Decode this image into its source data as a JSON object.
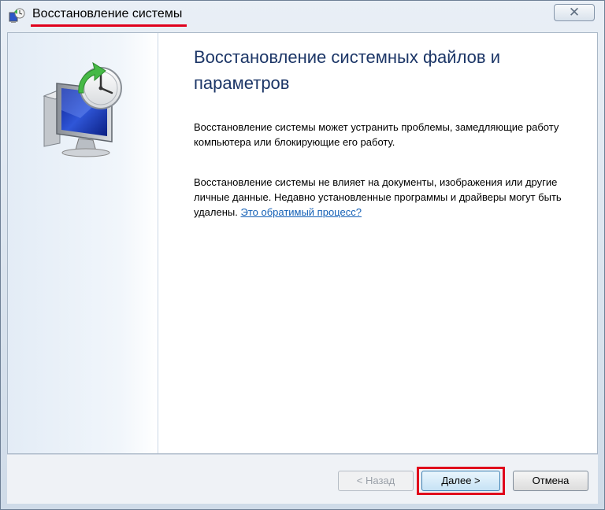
{
  "window": {
    "title": "Восстановление системы",
    "close_glyph": "✕"
  },
  "content": {
    "heading": "Восстановление системных файлов и параметров",
    "paragraph1": "Восстановление системы может устранить проблемы, замедляющие работу компьютера или блокирующие его работу.",
    "paragraph2": "Восстановление системы не влияет на документы, изображения или другие личные данные. Недавно установленные программы и драйверы могут быть удалены.",
    "link": "Это обратимый процесс?"
  },
  "buttons": {
    "back": "< Назад",
    "next": "Далее >",
    "cancel": "Отмена"
  },
  "icons": {
    "title_icon": "system-restore-icon",
    "hero_icon": "monitor-clock-restore-icon"
  },
  "colors": {
    "highlight": "#e0001c",
    "heading": "#1c3667",
    "link": "#1460b6"
  }
}
